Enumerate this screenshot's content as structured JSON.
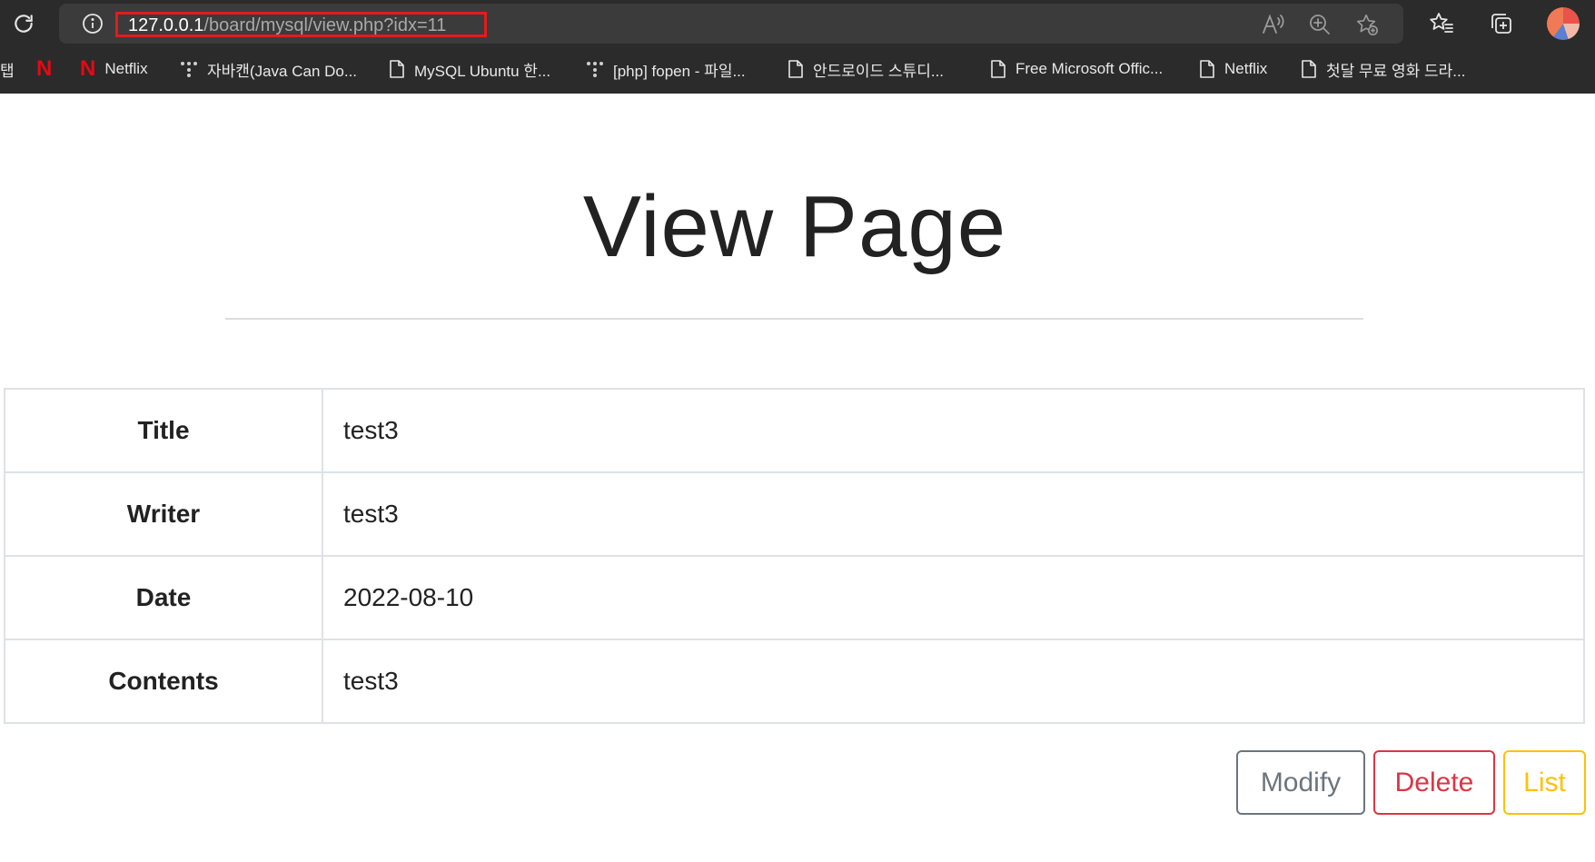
{
  "browser": {
    "url_host": "127.0.0.1",
    "url_path": "/board/mysql/view.php?idx=11",
    "bookmarks": [
      {
        "icon": "tab-fragment",
        "label": "탭"
      },
      {
        "icon": "netflix-icon",
        "label": ""
      },
      {
        "icon": "netflix-icon",
        "label": "Netflix"
      },
      {
        "icon": "dots-icon",
        "label": "자바캔(Java Can Do..."
      },
      {
        "icon": "page-icon",
        "label": "MySQL Ubuntu 한..."
      },
      {
        "icon": "dots-icon",
        "label": "[php] fopen - 파일..."
      },
      {
        "icon": "page-icon",
        "label": "안드로이드 스튜디..."
      },
      {
        "icon": "page-icon",
        "label": "Free Microsoft Offic..."
      },
      {
        "icon": "page-icon",
        "label": "Netflix"
      },
      {
        "icon": "page-icon",
        "label": "첫달 무료 영화 드라..."
      }
    ],
    "netflix_glyph": "N"
  },
  "page": {
    "title": "View Page"
  },
  "record": {
    "rows": [
      {
        "label": "Title",
        "value": "test3"
      },
      {
        "label": "Writer",
        "value": "test3"
      },
      {
        "label": "Date",
        "value": "2022-08-10"
      },
      {
        "label": "Contents",
        "value": "test3"
      }
    ]
  },
  "actions": {
    "modify_label": "Modify",
    "delete_label": "Delete",
    "list_label": "List"
  },
  "colors": {
    "chrome_bg": "#2b2b2b",
    "url_highlight": "#e21c1c",
    "modify": "#6c757d",
    "delete": "#dc3545",
    "list": "#ffc107"
  }
}
